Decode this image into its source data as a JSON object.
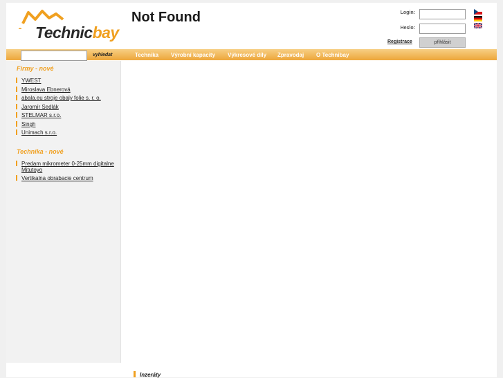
{
  "header": {
    "logo_text_a": "Technic",
    "logo_text_b": "bay",
    "title": "Not Found"
  },
  "login": {
    "login_label": "Login:",
    "password_label": "Heslo:",
    "register_label": "Registrace",
    "submit_label": "přihlásit",
    "flags": [
      "czech-flag-icon",
      "german-flag-icon",
      "uk-flag-icon"
    ]
  },
  "search": {
    "button_label": "vyhledat"
  },
  "nav": {
    "items": [
      "Technika",
      "Výrobní kapacity",
      "Výkresové díly",
      "Zpravodaj",
      "O Technibay"
    ]
  },
  "sidebar": {
    "firms_title": "Firmy - nové",
    "firms": [
      "YWEST",
      "Miroslava Ebnerová",
      "abala.eu stroje obaly folie s. r. o.",
      "Jaromír Sedlák",
      "STELMAR s.r.o.",
      "Singh",
      "Unimach s.r.o."
    ],
    "tech_title": "Technika - nové",
    "tech": [
      "Predam mikrometer 0-25mm digitalne Mitutoyo",
      "Vertikalna obrabacie centrum"
    ]
  },
  "footer": {
    "label": "Inzeráty"
  },
  "colors": {
    "accent": "#f0a020",
    "nav_gradient_top": "#f7cf85",
    "nav_gradient_bottom": "#eda63a"
  }
}
